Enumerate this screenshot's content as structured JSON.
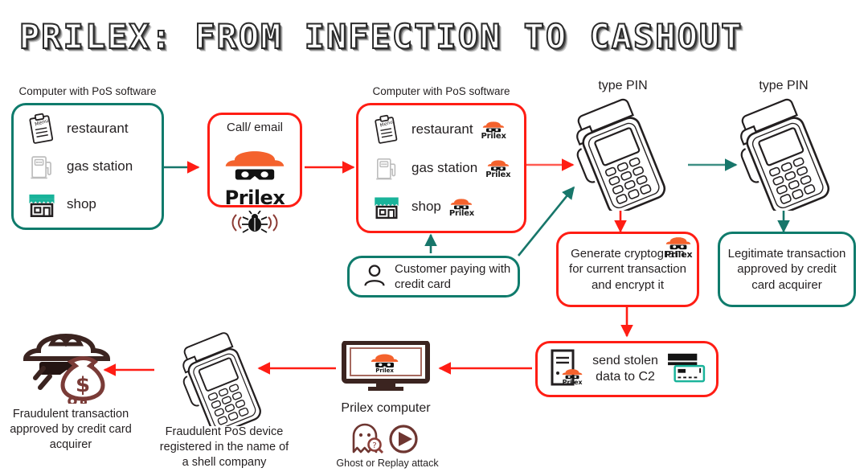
{
  "title": "PRILEX: FROM INFECTION TO CASHOUT",
  "colors": {
    "teal": "#0f7b6c",
    "red": "#ff1d14",
    "orange": "#f4622d",
    "dark": "#231f20",
    "maroon": "#7a3b37"
  },
  "clean_pos": {
    "label": "Computer with PoS software",
    "items": [
      {
        "icon": "menu-clipboard-icon",
        "label": "restaurant",
        "infected": false
      },
      {
        "icon": "gas-pump-icon",
        "label": "gas station",
        "infected": false
      },
      {
        "icon": "shop-storefront-icon",
        "label": "shop",
        "infected": false
      }
    ]
  },
  "infection": {
    "label": "Call/ email",
    "logo_text": "Prilex",
    "under_icon": "malware-bug-signal-icon"
  },
  "infected_pos": {
    "label": "Computer with PoS software",
    "badge_text": "Prilex",
    "items": [
      {
        "icon": "menu-clipboard-icon",
        "label": "restaurant",
        "infected": true
      },
      {
        "icon": "gas-pump-icon",
        "label": "gas station",
        "infected": true
      },
      {
        "icon": "shop-storefront-icon",
        "label": "shop",
        "infected": true
      }
    ]
  },
  "customer": {
    "icon": "person-icon",
    "text": "Customer paying with credit card"
  },
  "terminal_infected": {
    "label": "type PIN",
    "icon": "pos-terminal-icon"
  },
  "terminal_clean": {
    "label": "type PIN",
    "icon": "pos-terminal-icon"
  },
  "cryptogram": {
    "text": "Generate cryptogram for current transaction and encrypt it",
    "badge_text": "Prilex"
  },
  "legit": {
    "text": "Legitimate transaction approved by credit card acquirer"
  },
  "c2": {
    "text": "send stolen data to C2",
    "badge_text": "Prilex",
    "left_icon": "server-icon",
    "right_icon": "credit-cards-icon"
  },
  "prilex_computer": {
    "caption": "Prilex computer",
    "logo_text": "Prilex",
    "attack_caption": "Ghost or Replay attack",
    "attack_icons": [
      "ghost-question-icon",
      "replay-play-icon"
    ]
  },
  "fraud_device": {
    "caption": "Fraudulent PoS device registered in the name of a shell company",
    "icon": "pos-terminal-icon"
  },
  "fraud_result": {
    "caption": "Fraudulent transaction approved by credit card acquirer",
    "icon": "thief-money-bag-icon"
  }
}
